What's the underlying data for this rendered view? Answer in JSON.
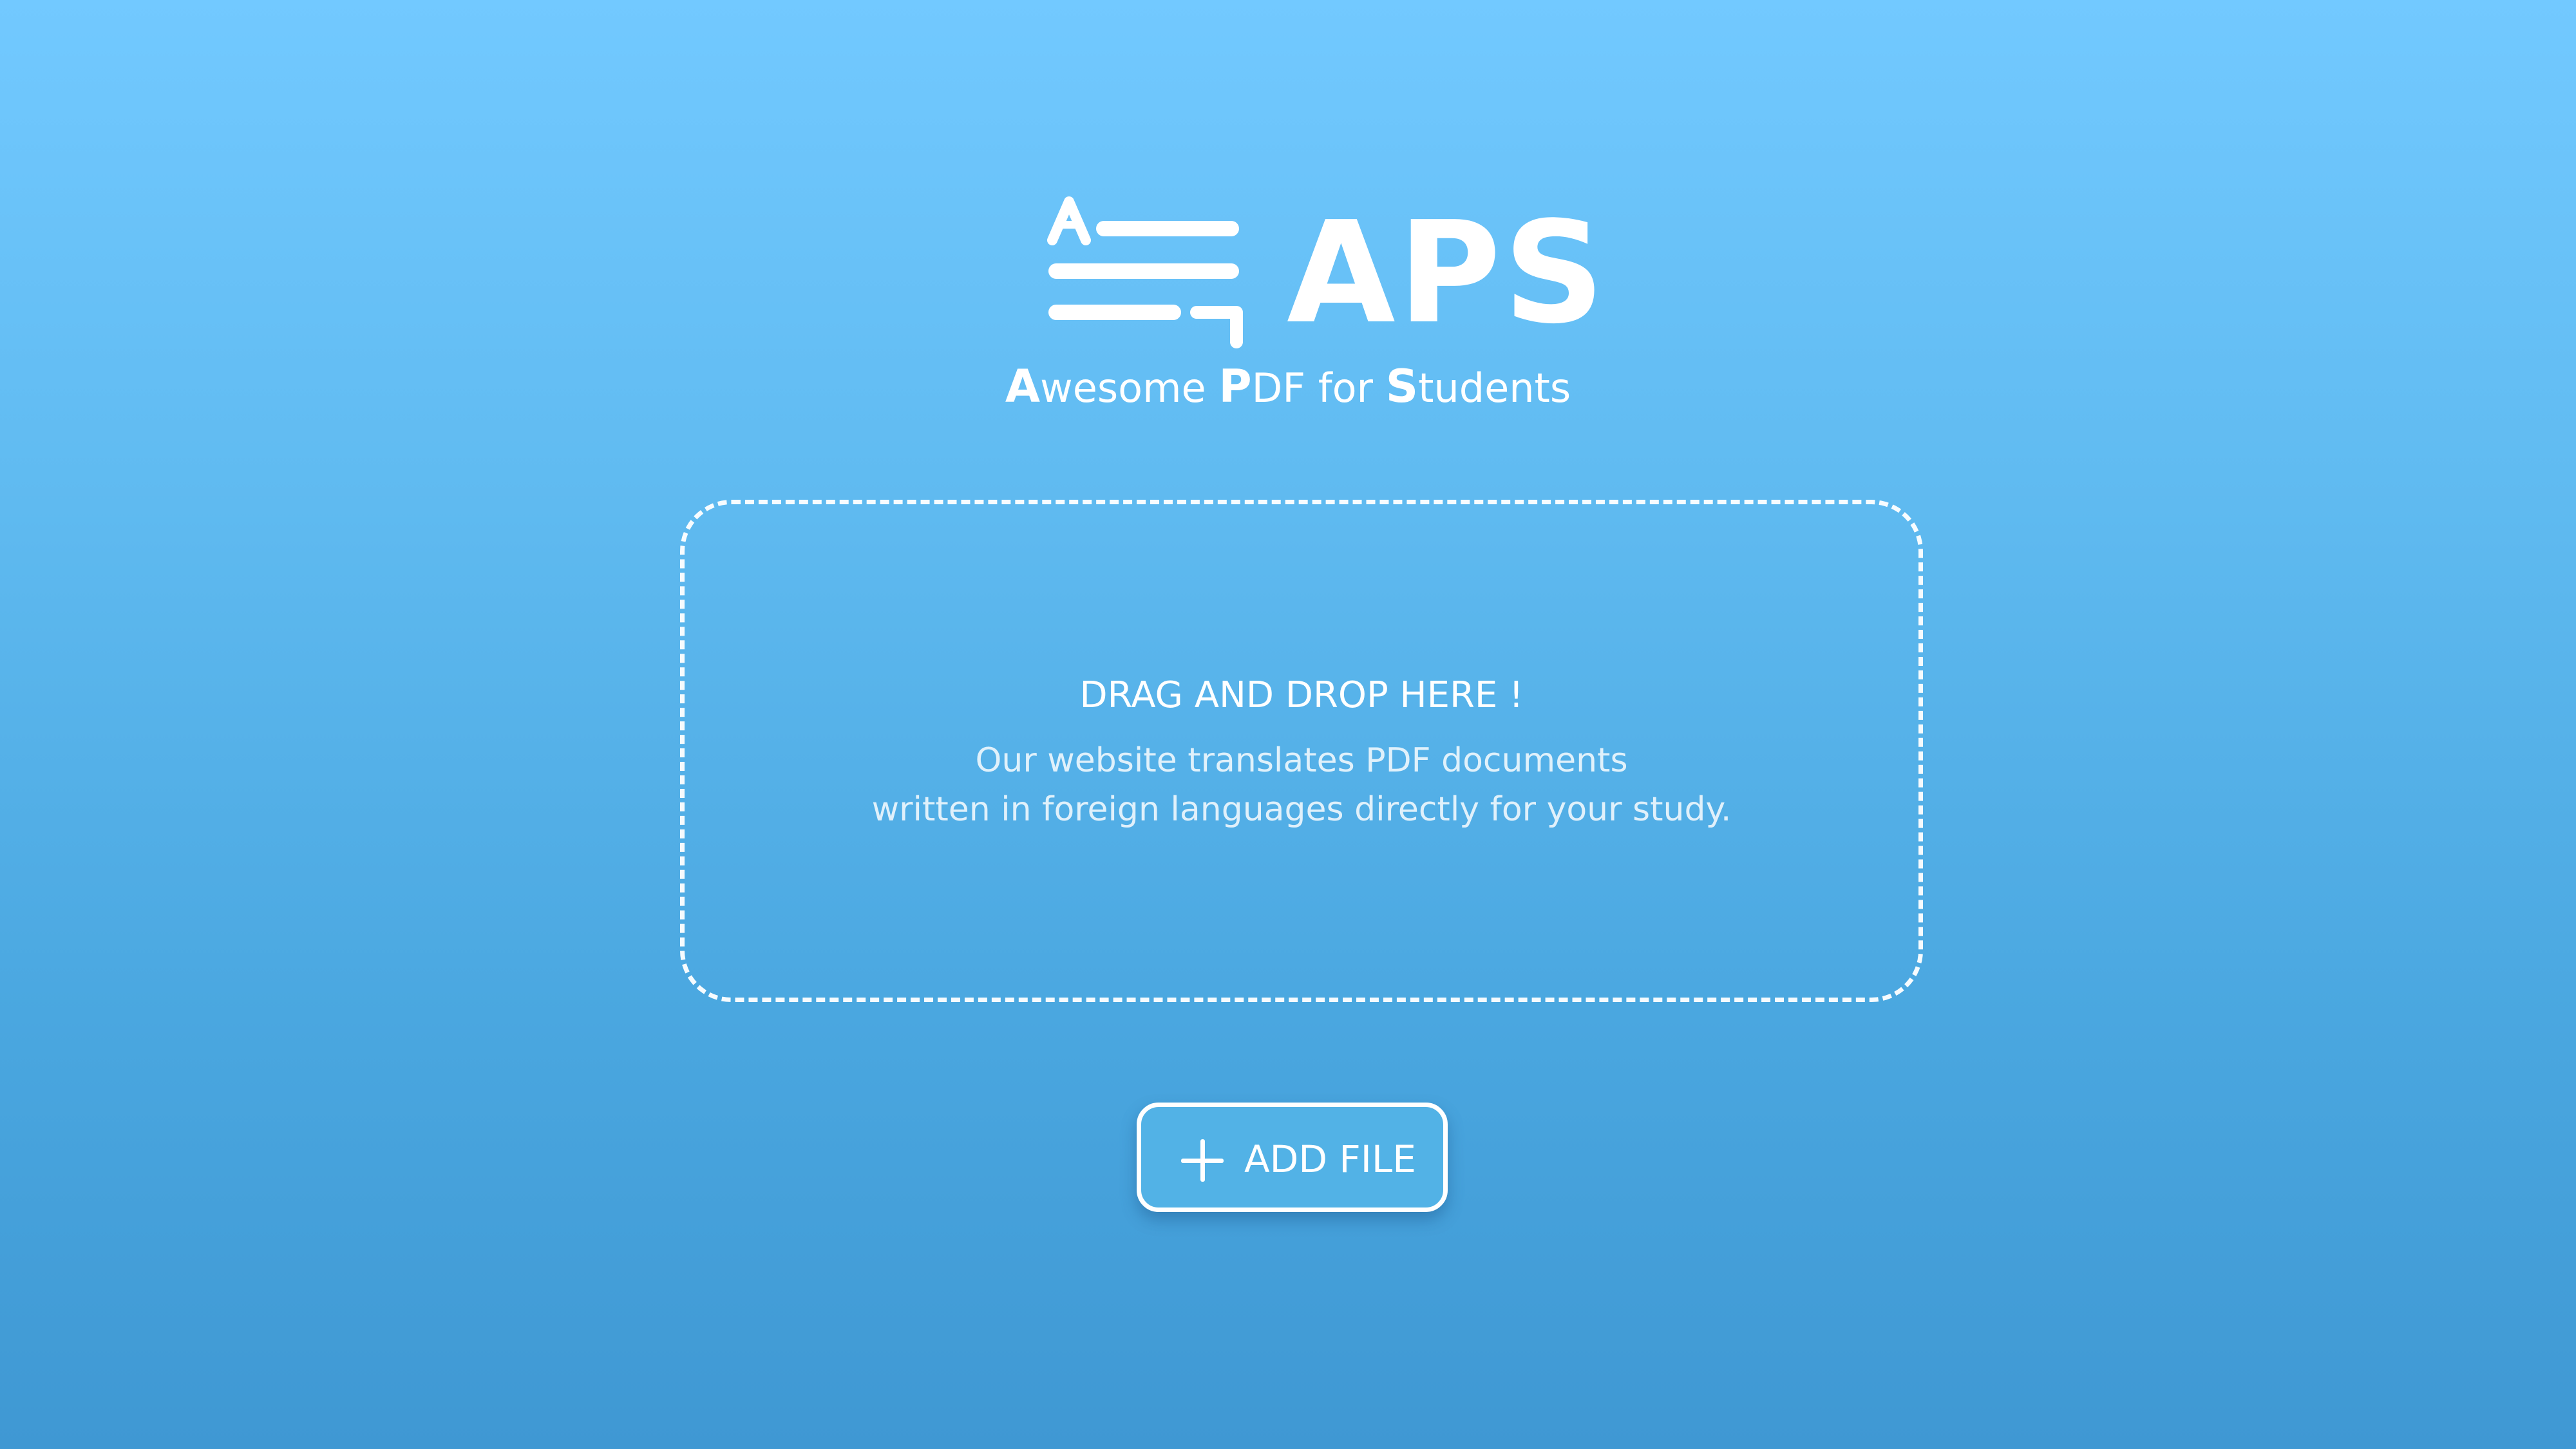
{
  "brand": {
    "logo_icon": "translate-lines-icon",
    "name": "APS",
    "tagline": [
      {
        "cap": "A",
        "rest": "wesome "
      },
      {
        "cap": "P",
        "rest": "DF for "
      },
      {
        "cap": "S",
        "rest": "tudents"
      }
    ]
  },
  "dropzone": {
    "title": "DRAG AND DROP HERE !",
    "description_line1": "Our website translates PDF documents",
    "description_line2": "written in foreign languages directly for your study."
  },
  "add_button": {
    "icon": "plus-icon",
    "label": "ADD FILE"
  },
  "colors": {
    "background_top": "#72c9ff",
    "background_bottom": "#3f98d3",
    "button_fill": "#52b2e6",
    "foreground": "#ffffff"
  }
}
